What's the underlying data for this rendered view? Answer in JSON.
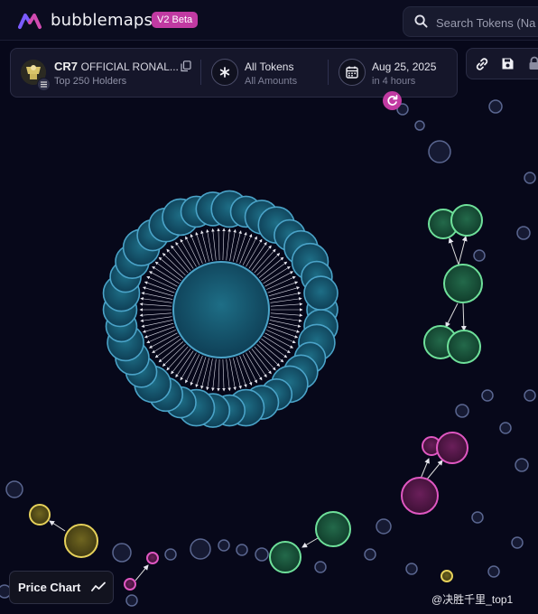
{
  "app": {
    "name": "bubblemaps",
    "badge": "V2 Beta"
  },
  "search": {
    "placeholder": "Search Tokens (Na"
  },
  "token": {
    "symbol": "CR7",
    "name": "OFFICIAL RONAL...",
    "subtitle": "Top 250 Holders"
  },
  "filter": {
    "title": "All Tokens",
    "subtitle": "All Amounts"
  },
  "date": {
    "title": "Aug 25, 2025",
    "subtitle": "in 4 hours"
  },
  "price_chart": {
    "label": "Price Chart"
  },
  "watermark": {
    "text": "@决胜千里_top1"
  },
  "icons": [
    "search-icon",
    "copy-icon",
    "asterisk-icon",
    "calendar-icon",
    "link-icon",
    "save-icon",
    "lock-icon",
    "refresh-icon",
    "trend-icon"
  ],
  "colors": {
    "accent": "#c13aa2",
    "cluster_blue": "#4aa3c8",
    "green": "#5fd08a",
    "magenta": "#d94bb8",
    "yellow": "#e6d15a",
    "dark_node": "#3a4a6a"
  }
}
